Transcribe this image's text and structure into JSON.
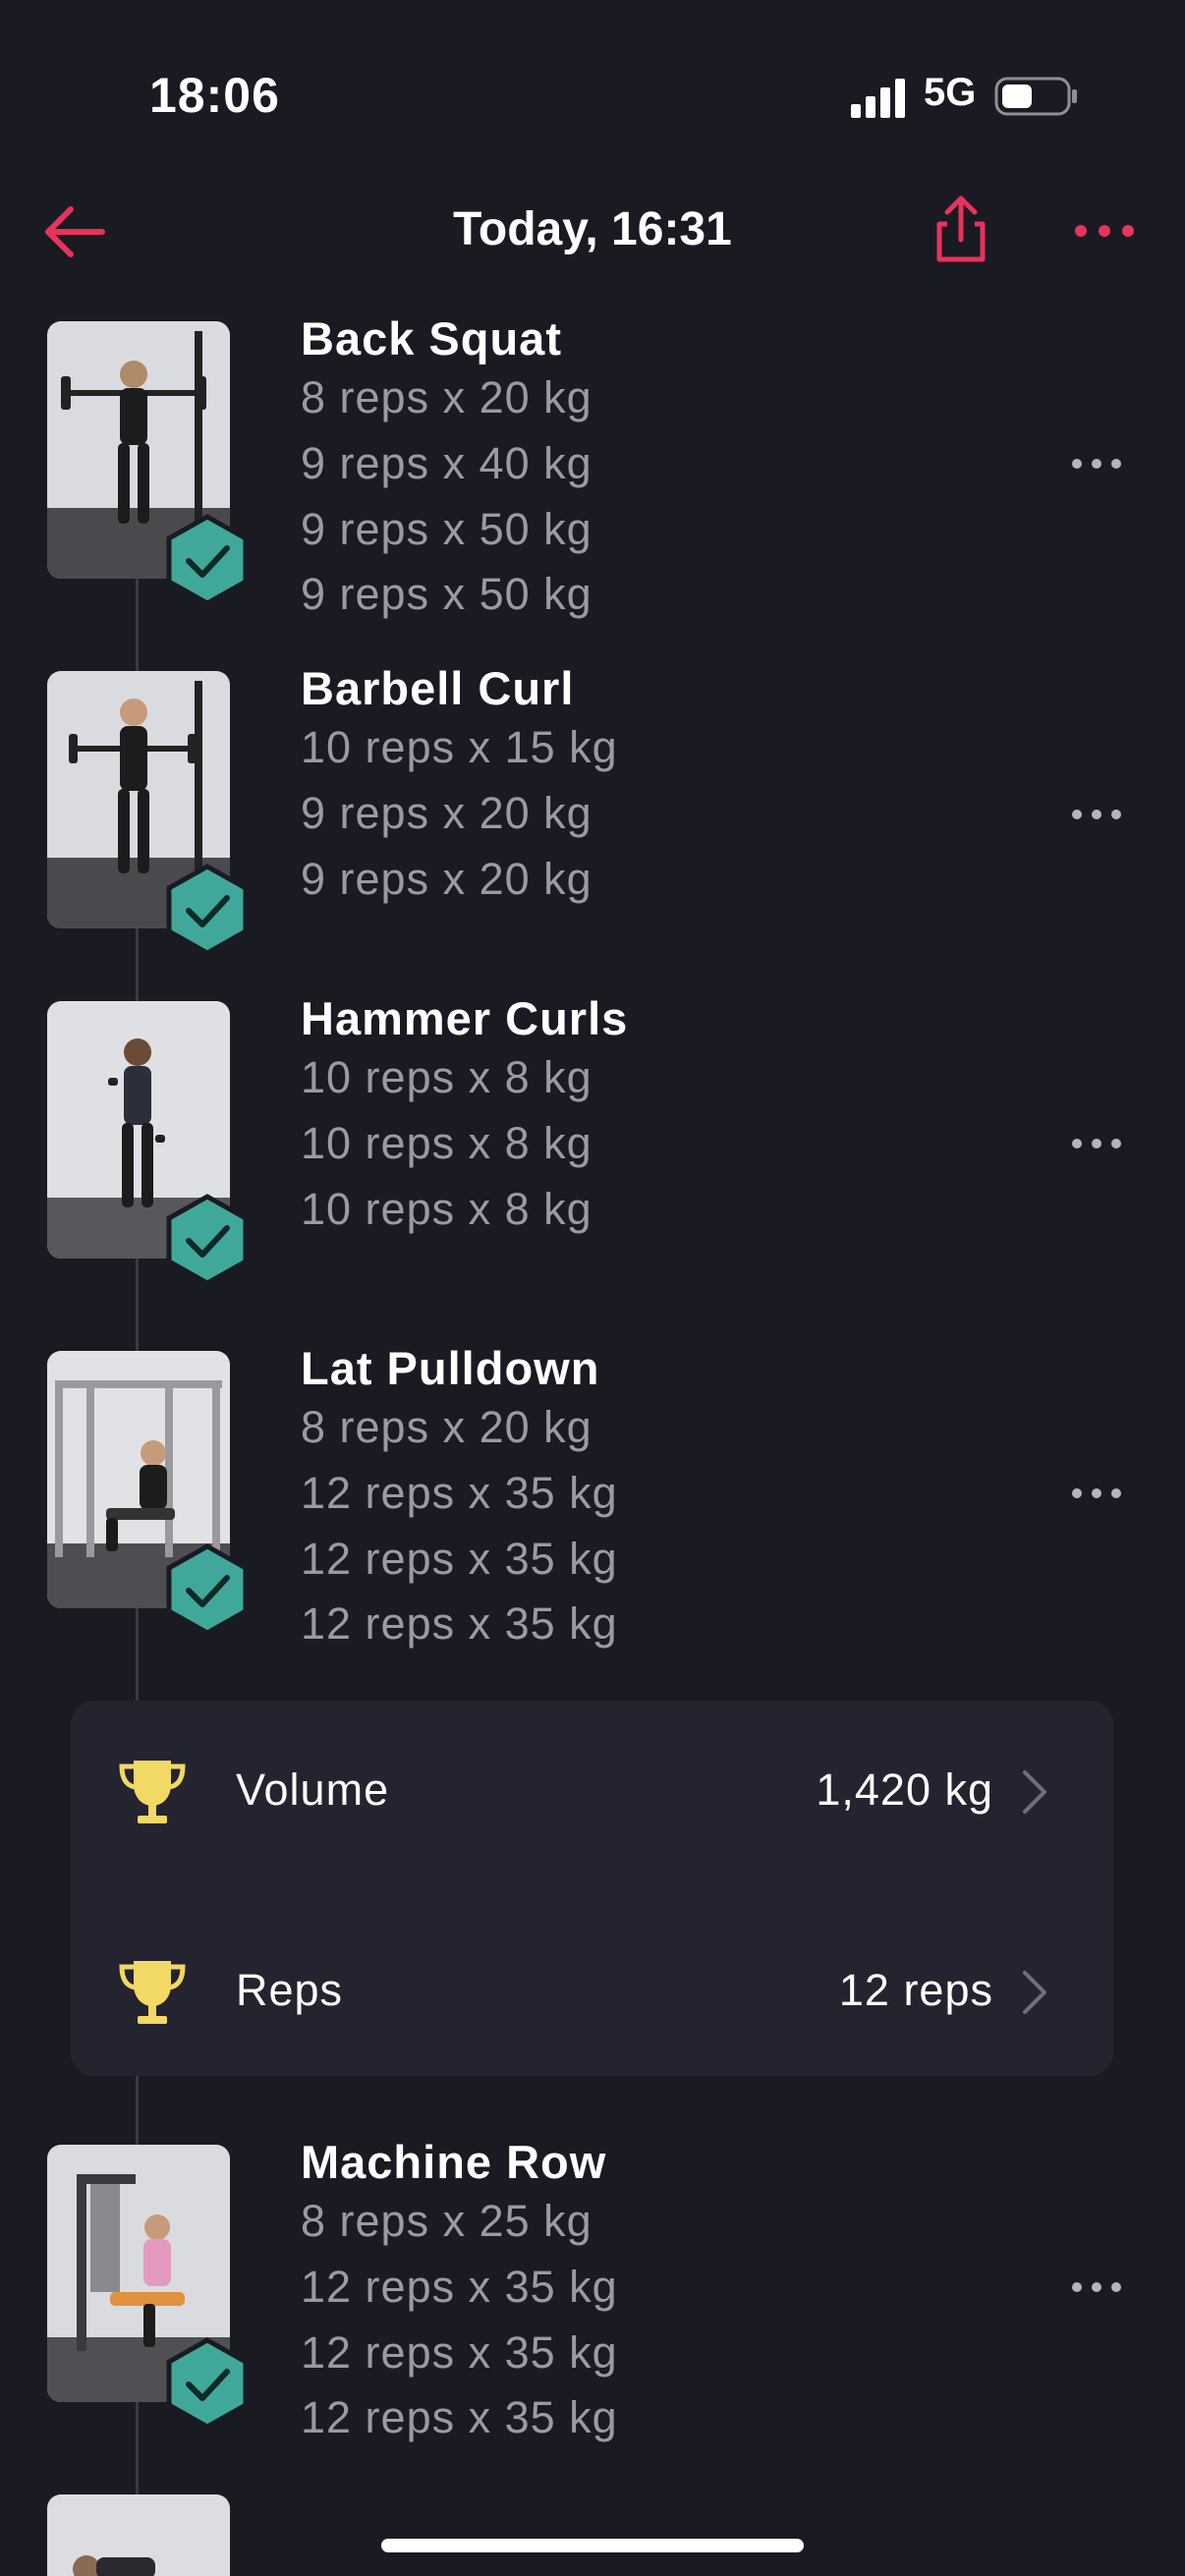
{
  "status": {
    "time": "18:06",
    "network": "5G"
  },
  "header": {
    "title": "Today, 16:31"
  },
  "exercises": [
    {
      "name": "Back Squat",
      "sets": [
        "8 reps x 20 kg",
        "9 reps x 40 kg",
        "9 reps x 50 kg",
        "9 reps x 50 kg"
      ]
    },
    {
      "name": "Barbell Curl",
      "sets": [
        "10 reps x 15 kg",
        "9 reps x 20 kg",
        "9 reps x 20 kg"
      ]
    },
    {
      "name": "Hammer Curls",
      "sets": [
        "10 reps x 8 kg",
        "10 reps x 8 kg",
        "10 reps x 8 kg"
      ]
    },
    {
      "name": "Lat Pulldown",
      "sets": [
        "8 reps x 20 kg",
        "12 reps x 35 kg",
        "12 reps x 35 kg",
        "12 reps x 35 kg"
      ]
    },
    {
      "name": "Machine Row",
      "sets": [
        "8 reps x 25 kg",
        "12 reps x 35 kg",
        "12 reps x 35 kg",
        "12 reps x 35 kg"
      ]
    }
  ],
  "records": [
    {
      "label": "Volume",
      "value": "1,420 kg"
    },
    {
      "label": "Reps",
      "value": "12 reps"
    }
  ],
  "colors": {
    "accent": "#e8335b",
    "badge": "#3fa89a",
    "trophy": "#f2d864",
    "background": "#1a1a23",
    "card": "#242430",
    "muted_text": "#9a9aa6"
  },
  "icons": {
    "back": "arrow-left-icon",
    "share": "share-icon",
    "more": "ellipsis-icon",
    "check": "check-hexagon-icon",
    "trophy": "trophy-icon",
    "chevron": "chevron-right-icon"
  }
}
